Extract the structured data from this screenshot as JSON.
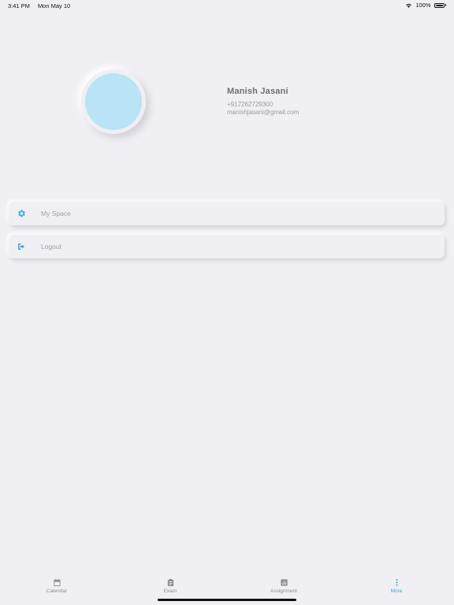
{
  "status_bar": {
    "time": "3:41 PM",
    "date": "Mon May 10",
    "battery": "100%"
  },
  "profile": {
    "name": "Manish Jasani",
    "phone": "+917262729300",
    "email": "manishjasani@gmail.com",
    "avatar_color": "#b8e4f5"
  },
  "menu": {
    "items": [
      {
        "label": "My Space",
        "icon": "gear-icon"
      },
      {
        "label": "Logout",
        "icon": "logout-icon"
      }
    ]
  },
  "tabs": [
    {
      "label": "Calendar",
      "icon": "calendar-icon",
      "active": false
    },
    {
      "label": "Exam",
      "icon": "clipboard-icon",
      "active": false
    },
    {
      "label": "Assignment",
      "icon": "bar-chart-icon",
      "active": false
    },
    {
      "label": "More",
      "icon": "more-vertical-icon",
      "active": true
    }
  ],
  "colors": {
    "accent": "#3aa9d8",
    "background": "#f0eff3"
  }
}
